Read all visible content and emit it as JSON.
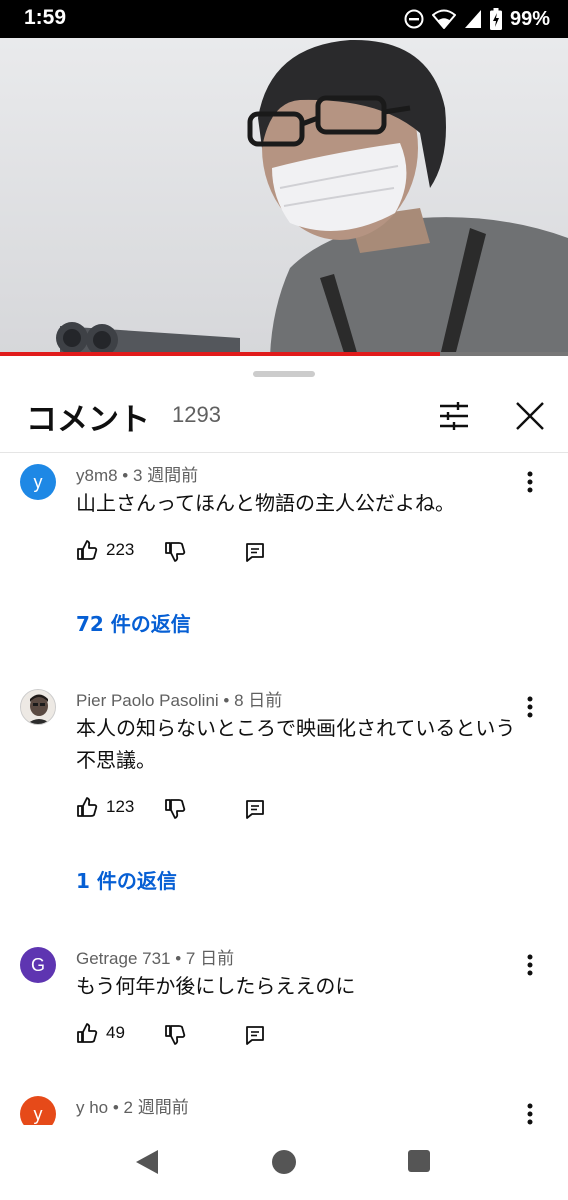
{
  "status_bar": {
    "time": "1:59",
    "battery": "99%",
    "icons": [
      "dnd-icon",
      "wifi-icon",
      "signal-icon",
      "battery-charging-icon"
    ]
  },
  "video": {
    "progress": 0.775,
    "progress_color": "#e01b1b"
  },
  "comments_panel": {
    "title": "コメント",
    "count": "1293",
    "icons": [
      "filter-icon",
      "close-icon"
    ]
  },
  "comments": [
    {
      "avatar_letter": "y",
      "avatar_color": "#1e88e5",
      "author": "y8m8",
      "time": "3 週間前",
      "meta": "y8m8 • 3 週間前",
      "text": "山上さんってほんと物語の主人公だよね。",
      "likes": "223",
      "replies": "72 件の返信"
    },
    {
      "avatar_letter": "",
      "avatar_color": "#9e9e9e",
      "author": "Pier Paolo Pasolini",
      "time": "8 日前",
      "meta": "Pier Paolo Pasolini • 8 日前",
      "text": "本人の知らないところで映画化されているという不思議。",
      "likes": "123",
      "replies": "1 件の返信"
    },
    {
      "avatar_letter": "G",
      "avatar_color": "#5e35b1",
      "author": "Getrage 731",
      "time": "7 日前",
      "meta": "Getrage 731 • 7 日前",
      "text": "もう何年か後にしたらええのに",
      "likes": "49",
      "replies": ""
    },
    {
      "avatar_letter": "y",
      "avatar_color": "#e64a19",
      "author": "y ho",
      "time": "2 週間前",
      "meta": "y ho • 2 週間前",
      "text": "",
      "likes": "",
      "replies": ""
    }
  ],
  "nav_bar": {
    "icons": [
      "back-icon",
      "home-icon",
      "recents-icon"
    ]
  }
}
